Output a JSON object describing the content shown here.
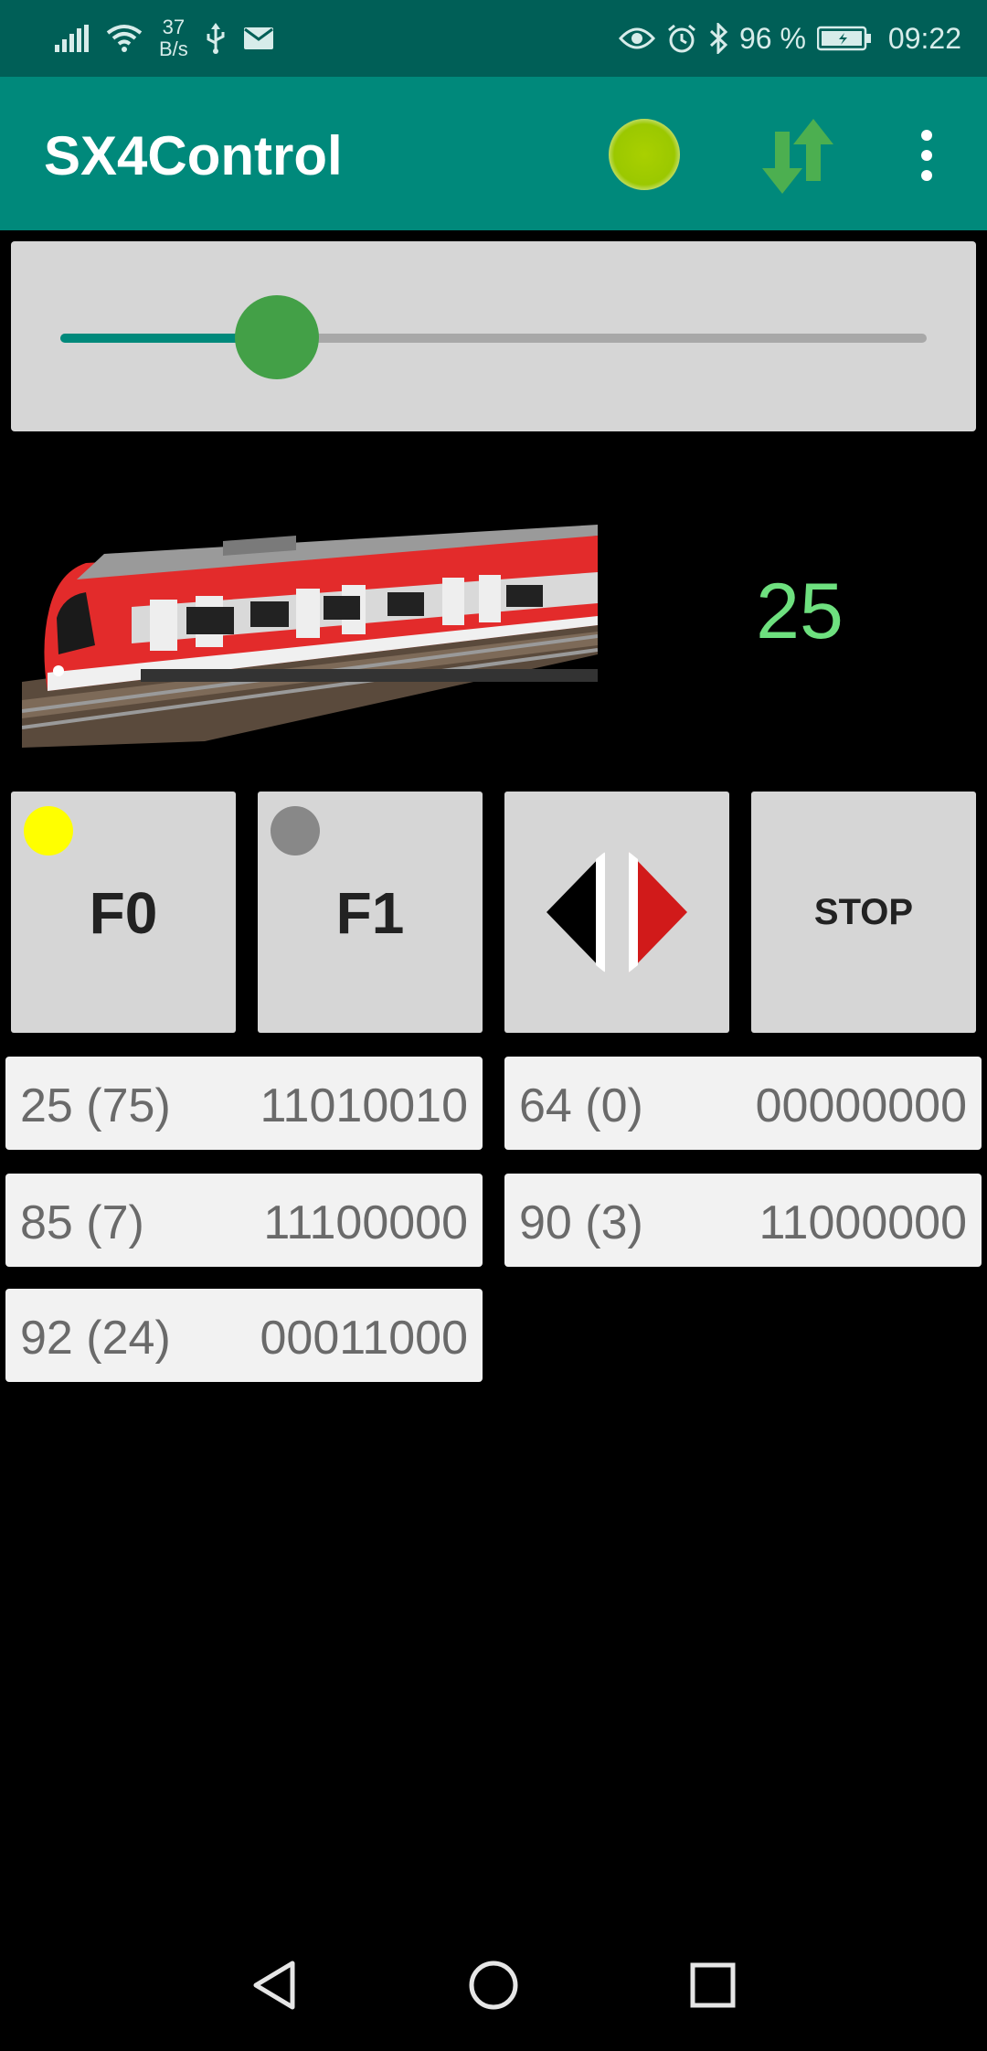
{
  "status_bar": {
    "net_speed_value": "37",
    "net_speed_unit": "B/s",
    "battery_percent": "96 %",
    "time": "09:22",
    "icons": [
      "signal-icon",
      "wifi-icon",
      "usb-icon",
      "mail-icon",
      "eye-icon",
      "alarm-icon",
      "bluetooth-icon",
      "battery-icon"
    ]
  },
  "app_bar": {
    "title": "SX4Control",
    "connection_color": "#a4cc00",
    "sync_icon_color": "#4caf50"
  },
  "speed_slider": {
    "value_fraction": 0.25
  },
  "loco": {
    "speed_display": "25"
  },
  "function_buttons": {
    "f0": {
      "label": "F0",
      "lamp_color": "#ffff00"
    },
    "f1": {
      "label": "F1",
      "lamp_color": "#888888"
    },
    "direction": {
      "left_color": "#000000",
      "right_color": "#d11a1a"
    },
    "stop": {
      "label": "STOP"
    }
  },
  "sx_channels": [
    {
      "address": "25 (75)",
      "bits": "11010010"
    },
    {
      "address": "64 (0)",
      "bits": "00000000"
    },
    {
      "address": "85 (7)",
      "bits": "11100000"
    },
    {
      "address": "90 (3)",
      "bits": "11000000"
    },
    {
      "address": "92 (24)",
      "bits": "00011000"
    }
  ],
  "nav_bar": {
    "icons": [
      "back-icon",
      "home-icon",
      "recents-icon"
    ]
  }
}
